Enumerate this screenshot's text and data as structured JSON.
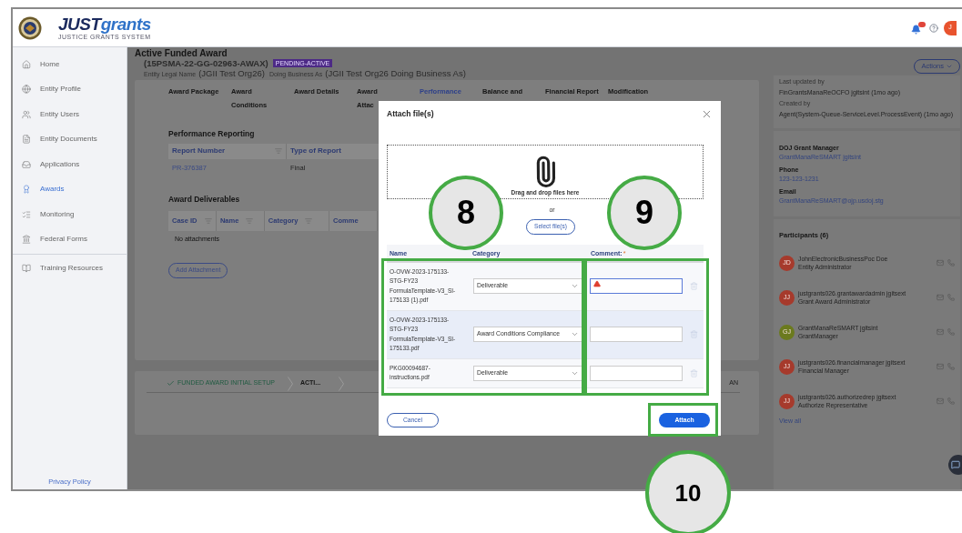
{
  "header": {
    "brand_bold": "JUST",
    "brand_rest": "grants",
    "tagline": "JUSTICE GRANTS SYSTEM",
    "avatar": "J"
  },
  "sidebar": {
    "items": [
      {
        "label": "Home",
        "selected": false
      },
      {
        "label": "Entity Profile",
        "selected": false
      },
      {
        "label": "Entity Users",
        "selected": false
      },
      {
        "label": "Entity Documents",
        "selected": false
      },
      {
        "label": "Applications",
        "selected": false
      },
      {
        "label": "Awards",
        "selected": true
      },
      {
        "label": "Monitoring",
        "selected": false
      },
      {
        "label": "Federal Forms",
        "selected": false
      },
      {
        "label": "Training Resources",
        "selected": false
      }
    ],
    "footer_link": "Privacy Policy"
  },
  "page": {
    "title": "Active Funded Award",
    "award_id": "(15PSMA-22-GG-02963-AWAX)",
    "status": "PENDING-ACTIVE",
    "legal_name_label": "Entity Legal Name",
    "legal_name": "(JGII Test Org26)",
    "dba_label": "Doing Business As",
    "dba": "(JGII Test Org26 Doing Business As)",
    "actions": "Actions"
  },
  "tabs": [
    {
      "label": "Award Package",
      "selected": false
    },
    {
      "label": "Award\nConditions",
      "selected": false
    },
    {
      "label": "Award Details",
      "selected": false
    },
    {
      "label": "Award\nAttac",
      "selected": false
    },
    {
      "label": "Performance",
      "selected": true
    },
    {
      "label": "Balance and",
      "selected": false
    },
    {
      "label": "Financial Report",
      "selected": false
    },
    {
      "label": "Modification",
      "selected": false
    }
  ],
  "performance_reporting": {
    "title": "Performance Reporting",
    "columns": [
      "Report Number",
      "Type of Report"
    ],
    "rows": [
      [
        "PR-376387",
        "Final"
      ]
    ]
  },
  "award_deliverables": {
    "title": "Award Deliverables",
    "columns": [
      "Case ID",
      "Name",
      "Category",
      "Comme"
    ],
    "empty": "No attachments",
    "button": "Add Attachment"
  },
  "stepper": [
    {
      "label": "FUNDED AWARD INITIAL SETUP",
      "done": true
    },
    {
      "label": "ACTI...",
      "done": false
    },
    {
      "label": "AN",
      "done": false
    }
  ],
  "details": {
    "updated_label": "Last updated by",
    "updated": "FinGrantsManaReOCFO jgitsint (1mo ago)",
    "created_label": "Created by",
    "created": "Agent(System-Queue-ServiceLevel.ProcessEvent) (1mo ago)"
  },
  "manager": {
    "title": "DOJ Grant Manager",
    "name": "GrantManaReSMART jgitsint",
    "phone_label": "Phone",
    "phone": "123-123-1231",
    "email_label": "Email",
    "email": "GrantManaReSMART@ojp.usdoj.stg"
  },
  "participants": {
    "title": "Participants (6)",
    "view_all": "View all",
    "items": [
      {
        "initials": "JD",
        "color": "#a63a2c",
        "name": "JohnElectronicBusinessPoc Doe",
        "role": "Entity Administrator"
      },
      {
        "initials": "JJ",
        "color": "#a63a2c",
        "name": "justgrants026.grantawardadmin jgitsext",
        "role": "Grant Award Administrator"
      },
      {
        "initials": "GJ",
        "color": "#6b7a1e",
        "name": "GrantManaReSMART jgitsint",
        "role": "GrantManager"
      },
      {
        "initials": "JJ",
        "color": "#a63a2c",
        "name": "justgrants026.financialmanager jgitsext",
        "role": "Financial Manager"
      },
      {
        "initials": "JJ",
        "color": "#a63a2c",
        "name": "justgrants026.authorizedrep jgitsext",
        "role": "Authorize Representative"
      }
    ]
  },
  "dialog": {
    "title": "Attach file(s)",
    "drop_text": "Drag and drop files here",
    "or": "or",
    "select": "Select file(s)",
    "columns": [
      "Name",
      "Category",
      "Comment:"
    ],
    "required_mark": "*",
    "rows": [
      {
        "name": "O-OVW-2023-175133-STG-FY23 FormulaTemplate-V3_SI-175133 (1).pdf",
        "category": "Deliverable",
        "error": true,
        "highlighted": false
      },
      {
        "name": "O-OVW-2023-175133-STG-FY23 FormulaTemplate-V3_SI-175133.pdf",
        "category": "Award Conditions Compliance",
        "error": false,
        "highlighted": true
      },
      {
        "name": "PKG00094687-instructions.pdf",
        "category": "Deliverable",
        "error": false,
        "highlighted": false
      }
    ],
    "cancel": "Cancel",
    "attach": "Attach"
  },
  "callouts": [
    "8",
    "9",
    "10"
  ]
}
